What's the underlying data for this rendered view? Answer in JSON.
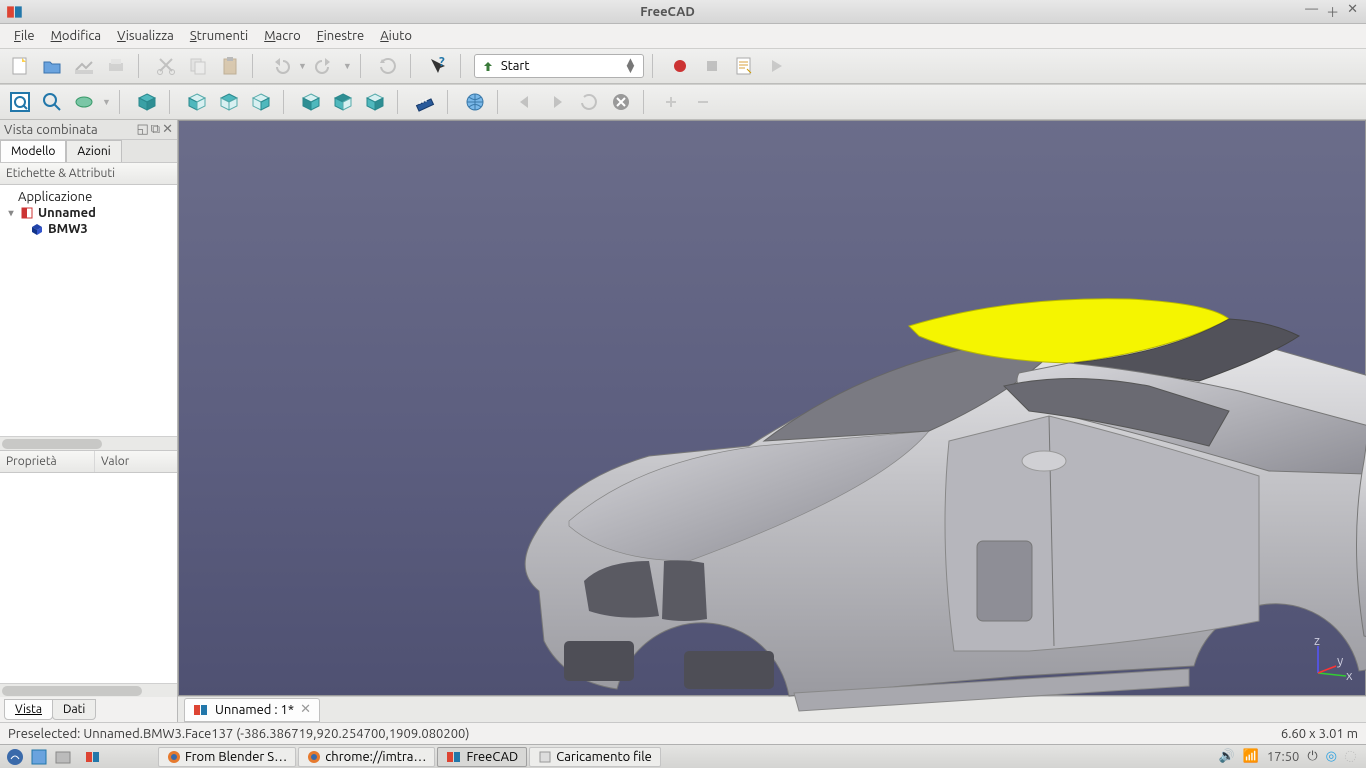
{
  "window": {
    "title": "FreeCAD"
  },
  "menu": {
    "items": [
      {
        "label": "File",
        "accel": "F"
      },
      {
        "label": "Modifica",
        "accel": "M"
      },
      {
        "label": "Visualizza",
        "accel": "V"
      },
      {
        "label": "Strumenti",
        "accel": "S"
      },
      {
        "label": "Macro",
        "accel": "M"
      },
      {
        "label": "Finestre",
        "accel": "F"
      },
      {
        "label": "Aiuto",
        "accel": "A"
      }
    ]
  },
  "workbench": {
    "selected": "Start"
  },
  "sidebar": {
    "panel_title": "Vista combinata",
    "tabs": {
      "model": "Modello",
      "actions": "Azioni"
    },
    "tree_header": "Etichette & Attributi",
    "tree": {
      "root": "Applicazione",
      "doc": "Unnamed",
      "item": "BMW3"
    },
    "props": {
      "col1": "Proprietà",
      "col2": "Valor"
    },
    "bottom_tabs": {
      "view": "Vista",
      "data": "Dati"
    }
  },
  "doc_tab": {
    "label": "Unnamed : 1*"
  },
  "status": {
    "left": "Preselected: Unnamed.BMW3.Face137 (-386.386719,920.254700,1909.080200)",
    "right": "6.60 x 3.01 m"
  },
  "taskbar": {
    "items": [
      {
        "label": "From Blender S…"
      },
      {
        "label": "chrome://imtra…"
      },
      {
        "label": "FreeCAD"
      },
      {
        "label": "Caricamento file"
      }
    ],
    "clock": "17:50"
  },
  "colors": {
    "viewport_top": "#6b6d8a",
    "selection_yellow": "#f5f500"
  }
}
